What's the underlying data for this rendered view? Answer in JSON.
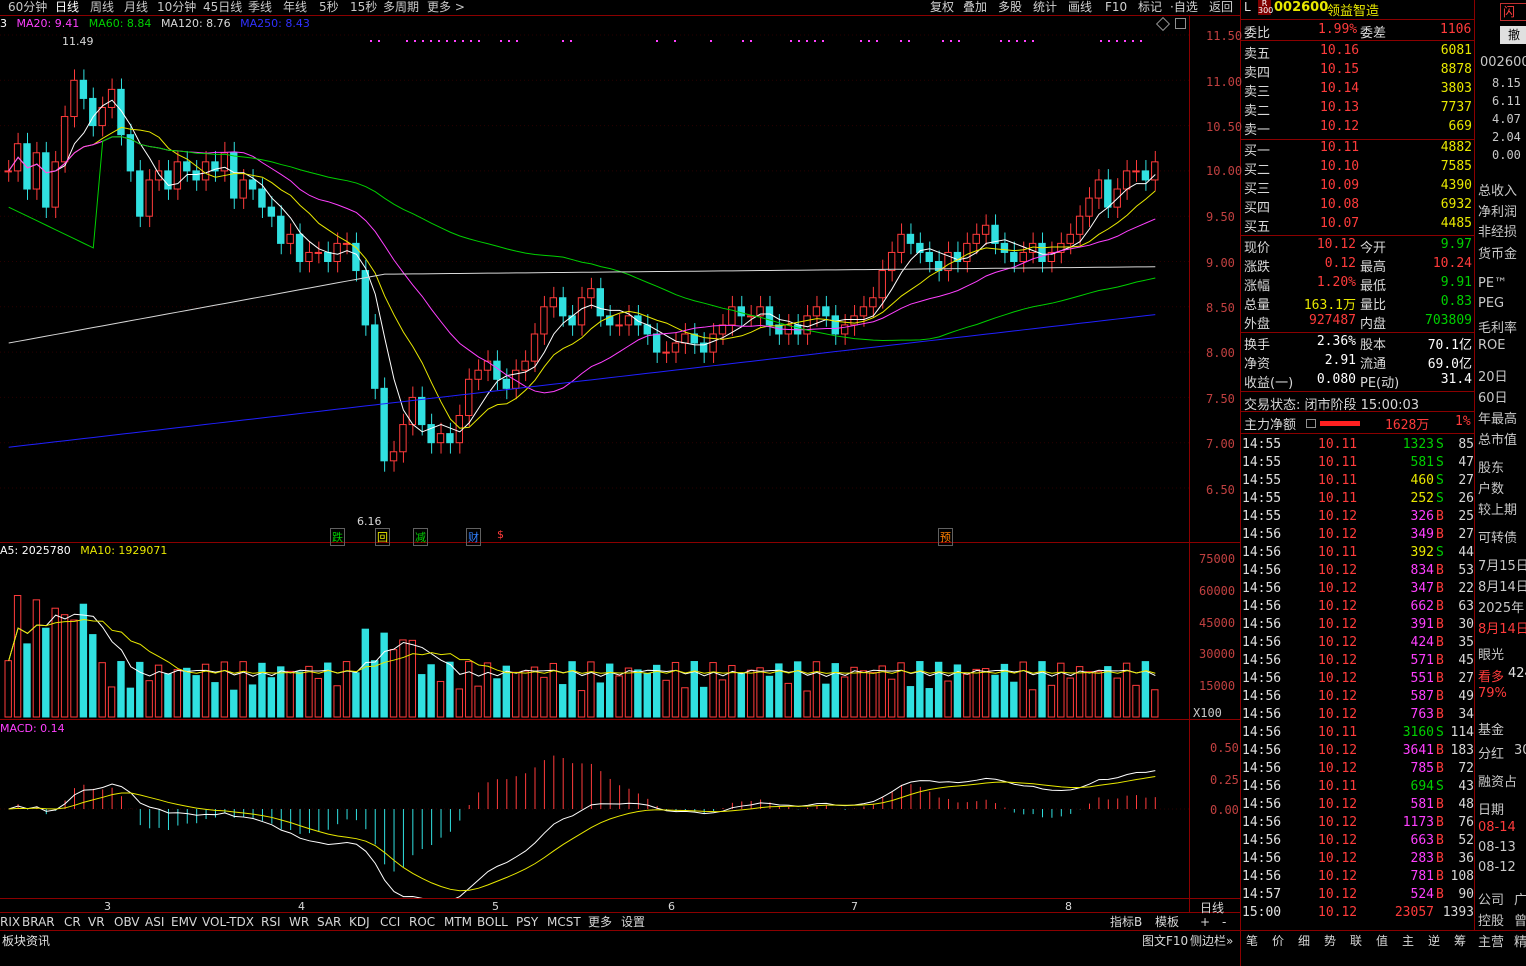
{
  "top_tabs": [
    "60分钟",
    "日线",
    "周线",
    "月线",
    "10分钟",
    "45日线",
    "季线",
    "年线",
    "5秒",
    "15秒",
    "多周期",
    "更多 >"
  ],
  "top_tools": [
    "复权",
    "叠加",
    "多股",
    "统计",
    "画线",
    "F10",
    "标记",
    "·自选",
    "返回"
  ],
  "main_legend": {
    "ma5": "3",
    "ma20": "MA20: 9.41",
    "ma60": "MA60: 8.84",
    "ma120": "MA120: 8.76",
    "ma250": "MA250: 8.43"
  },
  "price_axis": [
    "11.50",
    "11.00",
    "10.50",
    "10.00",
    "9.50",
    "9.00",
    "8.50",
    "8.00",
    "7.50",
    "7.00",
    "6.50"
  ],
  "annot": {
    "high": "11.49",
    "low": "6.16"
  },
  "event_tags": [
    "跌",
    "回",
    "减",
    "财",
    "$",
    "预"
  ],
  "vol_legend": {
    "ma5": "A5: 2025780",
    "ma10": "MA10: 1929071"
  },
  "vol_axis": [
    "75000",
    "60000",
    "45000",
    "30000",
    "15000"
  ],
  "vol_unit": "X100",
  "macd_legend": "MACD: 0.14",
  "macd_axis": [
    "0.50",
    "0.25",
    "0.00"
  ],
  "month_labels": [
    "3",
    "4",
    "5",
    "6",
    "7",
    "8"
  ],
  "period_label": "日线",
  "indicator_tabs": [
    "RIX",
    "BRAR",
    "CR",
    "VR",
    "OBV",
    "ASI",
    "EMV",
    "VOL-TDX",
    "RSI",
    "WR",
    "SAR",
    "KDJ",
    "CCI",
    "ROC",
    "MTM",
    "BOLL",
    "PSY",
    "MCST",
    "更多",
    "设置"
  ],
  "indicator_right": [
    "指标B",
    "模板"
  ],
  "status_left": "板块资讯",
  "status_right": [
    "图文F10",
    "侧边栏»"
  ],
  "stock": {
    "badge": "L",
    "code": "002600",
    "name": "领益智造"
  },
  "weibi": {
    "label": "委比",
    "value": "1.99%",
    "label2": "委差",
    "value2": "1106"
  },
  "asks": [
    {
      "label": "卖五",
      "price": "10.16",
      "vol": "6081"
    },
    {
      "label": "卖四",
      "price": "10.15",
      "vol": "8878"
    },
    {
      "label": "卖三",
      "price": "10.14",
      "vol": "3803"
    },
    {
      "label": "卖二",
      "price": "10.13",
      "vol": "7737"
    },
    {
      "label": "卖一",
      "price": "10.12",
      "vol": "669"
    }
  ],
  "bids": [
    {
      "label": "买一",
      "price": "10.11",
      "vol": "4882"
    },
    {
      "label": "买二",
      "price": "10.10",
      "vol": "7585"
    },
    {
      "label": "买三",
      "price": "10.09",
      "vol": "4390"
    },
    {
      "label": "买四",
      "price": "10.08",
      "vol": "6932"
    },
    {
      "label": "买五",
      "price": "10.07",
      "vol": "4485"
    }
  ],
  "stats": [
    {
      "l1": "现价",
      "v1": "10.12",
      "c1": "red",
      "l2": "今开",
      "v2": "9.97",
      "c2": "grn"
    },
    {
      "l1": "涨跌",
      "v1": "0.12",
      "c1": "red",
      "l2": "最高",
      "v2": "10.24",
      "c2": "red"
    },
    {
      "l1": "涨幅",
      "v1": "1.20%",
      "c1": "red",
      "l2": "最低",
      "v2": "9.91",
      "c2": "grn"
    },
    {
      "l1": "总量",
      "v1": "163.1万",
      "c1": "yel",
      "l2": "量比",
      "v2": "0.83",
      "c2": "grn"
    },
    {
      "l1": "外盘",
      "v1": "927487",
      "c1": "red",
      "l2": "内盘",
      "v2": "703809",
      "c2": "grn"
    }
  ],
  "fund": [
    {
      "l1": "换手",
      "v1": "2.36%",
      "l2": "股本",
      "v2": "70.1亿"
    },
    {
      "l1": "净资",
      "v1": "2.91",
      "l2": "流通",
      "v2": "69.0亿"
    },
    {
      "l1": "收益(一)",
      "v1": "0.080",
      "l2": "PE(动)",
      "v2": "31.4"
    }
  ],
  "trade_status": "交易状态: 闭市阶段 15:00:03",
  "main_flow": {
    "label": "主力净额",
    "value": "1628万",
    "pct": "1%"
  },
  "ticks": [
    [
      "14:55",
      "10.11",
      "1323",
      "S",
      "85"
    ],
    [
      "14:55",
      "10.11",
      "581",
      "S",
      "47"
    ],
    [
      "14:55",
      "10.11",
      "460",
      "S",
      "27"
    ],
    [
      "14:55",
      "10.11",
      "252",
      "S",
      "26"
    ],
    [
      "14:55",
      "10.12",
      "326",
      "B",
      "25"
    ],
    [
      "14:56",
      "10.12",
      "349",
      "B",
      "27"
    ],
    [
      "14:56",
      "10.11",
      "392",
      "S",
      "44"
    ],
    [
      "14:56",
      "10.12",
      "834",
      "B",
      "53"
    ],
    [
      "14:56",
      "10.12",
      "347",
      "B",
      "22"
    ],
    [
      "14:56",
      "10.12",
      "662",
      "B",
      "63"
    ],
    [
      "14:56",
      "10.12",
      "391",
      "B",
      "30"
    ],
    [
      "14:56",
      "10.12",
      "424",
      "B",
      "35"
    ],
    [
      "14:56",
      "10.12",
      "571",
      "B",
      "45"
    ],
    [
      "14:56",
      "10.12",
      "551",
      "B",
      "27"
    ],
    [
      "14:56",
      "10.12",
      "587",
      "B",
      "49"
    ],
    [
      "14:56",
      "10.12",
      "763",
      "B",
      "34"
    ],
    [
      "14:56",
      "10.11",
      "3160",
      "S",
      "114"
    ],
    [
      "14:56",
      "10.12",
      "3641",
      "B",
      "183"
    ],
    [
      "14:56",
      "10.12",
      "785",
      "B",
      "72"
    ],
    [
      "14:56",
      "10.11",
      "694",
      "S",
      "43"
    ],
    [
      "14:56",
      "10.12",
      "581",
      "B",
      "48"
    ],
    [
      "14:56",
      "10.12",
      "1173",
      "B",
      "76"
    ],
    [
      "14:56",
      "10.12",
      "663",
      "B",
      "52"
    ],
    [
      "14:56",
      "10.12",
      "283",
      "B",
      "36"
    ],
    [
      "14:56",
      "10.12",
      "781",
      "B",
      "108"
    ],
    [
      "14:57",
      "10.12",
      "524",
      "B",
      "90"
    ],
    [
      "15:00",
      "10.12",
      "23057",
      "",
      "1393"
    ]
  ],
  "bottom_tabs": [
    "笔",
    "价",
    "细",
    "势",
    "联",
    "值",
    "主",
    "逆",
    "筹"
  ],
  "far_right": {
    "code": "002600",
    "tag": "闪",
    "tag2": "撤",
    "nums": [
      "8.15",
      "6.11",
      "4.07",
      "2.04",
      "0.00"
    ],
    "labels": [
      "总收入",
      "净利润",
      "非经损",
      "货币金",
      "PE™",
      "PEG",
      "毛利率",
      "ROE",
      "20日",
      "60日",
      "年最高",
      "总市值",
      "股东",
      "户数",
      "较上期",
      "可转债",
      "7月15日",
      "8月14日",
      "2025年",
      "8月14日",
      "眼光",
      "看多",
      "79%",
      "基金",
      "分红",
      "融资占",
      "日期",
      "08-14",
      "08-13",
      "08-12",
      "公司",
      "控股",
      "主营"
    ],
    "extra": [
      "424",
      "30",
      "广",
      "曾",
      "精"
    ]
  },
  "colors": {
    "up": "#ff3b3b",
    "down": "#30e0e0",
    "ma5": "#ffffff",
    "ma10": "#e8e800",
    "ma20": "#ff40ff",
    "ma60": "#00d000",
    "ma120": "#d8d8d8",
    "ma250": "#2020ff",
    "border": "#8b0000"
  }
}
